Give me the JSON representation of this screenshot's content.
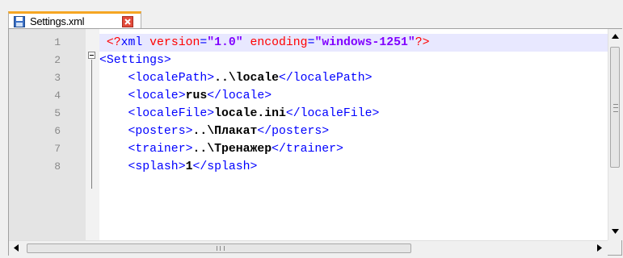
{
  "tab": {
    "label": "Settings.xml"
  },
  "editor": {
    "line_numbers": [
      "1",
      "2",
      "3",
      "4",
      "5",
      "6",
      "7",
      "8"
    ],
    "lines": [
      [
        {
          "c": "pi",
          "t": "<?"
        },
        {
          "c": "tag",
          "t": "xml"
        },
        {
          "c": "attr",
          "t": " version"
        },
        {
          "c": "tag",
          "t": "="
        },
        {
          "c": "val",
          "t": "\"1.0\""
        },
        {
          "c": "attr",
          "t": " encoding"
        },
        {
          "c": "tag",
          "t": "="
        },
        {
          "c": "val",
          "t": "\"windows-1251\""
        },
        {
          "c": "pi",
          "t": "?>"
        }
      ],
      [
        {
          "c": "tag",
          "t": "<Settings>"
        }
      ],
      [
        {
          "c": "txt",
          "t": "    "
        },
        {
          "c": "tag",
          "t": "<localePath>"
        },
        {
          "c": "txt",
          "t": "..\\locale"
        },
        {
          "c": "tag",
          "t": "</localePath>"
        }
      ],
      [
        {
          "c": "txt",
          "t": "    "
        },
        {
          "c": "tag",
          "t": "<locale>"
        },
        {
          "c": "txt",
          "t": "rus"
        },
        {
          "c": "tag",
          "t": "</locale>"
        }
      ],
      [
        {
          "c": "txt",
          "t": "    "
        },
        {
          "c": "tag",
          "t": "<localeFile>"
        },
        {
          "c": "txt",
          "t": "locale.ini"
        },
        {
          "c": "tag",
          "t": "</localeFile>"
        }
      ],
      [
        {
          "c": "txt",
          "t": "    "
        },
        {
          "c": "tag",
          "t": "<posters>"
        },
        {
          "c": "txt",
          "t": "..\\Плакат"
        },
        {
          "c": "tag",
          "t": "</posters>"
        }
      ],
      [
        {
          "c": "txt",
          "t": "    "
        },
        {
          "c": "tag",
          "t": "<trainer>"
        },
        {
          "c": "txt",
          "t": "..\\Тренажер"
        },
        {
          "c": "tag",
          "t": "</trainer>"
        }
      ],
      [
        {
          "c": "txt",
          "t": "    "
        },
        {
          "c": "tag",
          "t": "<splash>"
        },
        {
          "c": "txt",
          "t": "1"
        },
        {
          "c": "tag",
          "t": "</splash>"
        }
      ]
    ]
  },
  "colors": {
    "tab_accent": "#f5a623",
    "tag": "#0000ff",
    "attribute": "#ff0000",
    "value": "#8000ff",
    "current_line": "#e8e8ff"
  },
  "icons": {
    "tab_icon": "save-disk-icon",
    "close": "close-icon"
  }
}
